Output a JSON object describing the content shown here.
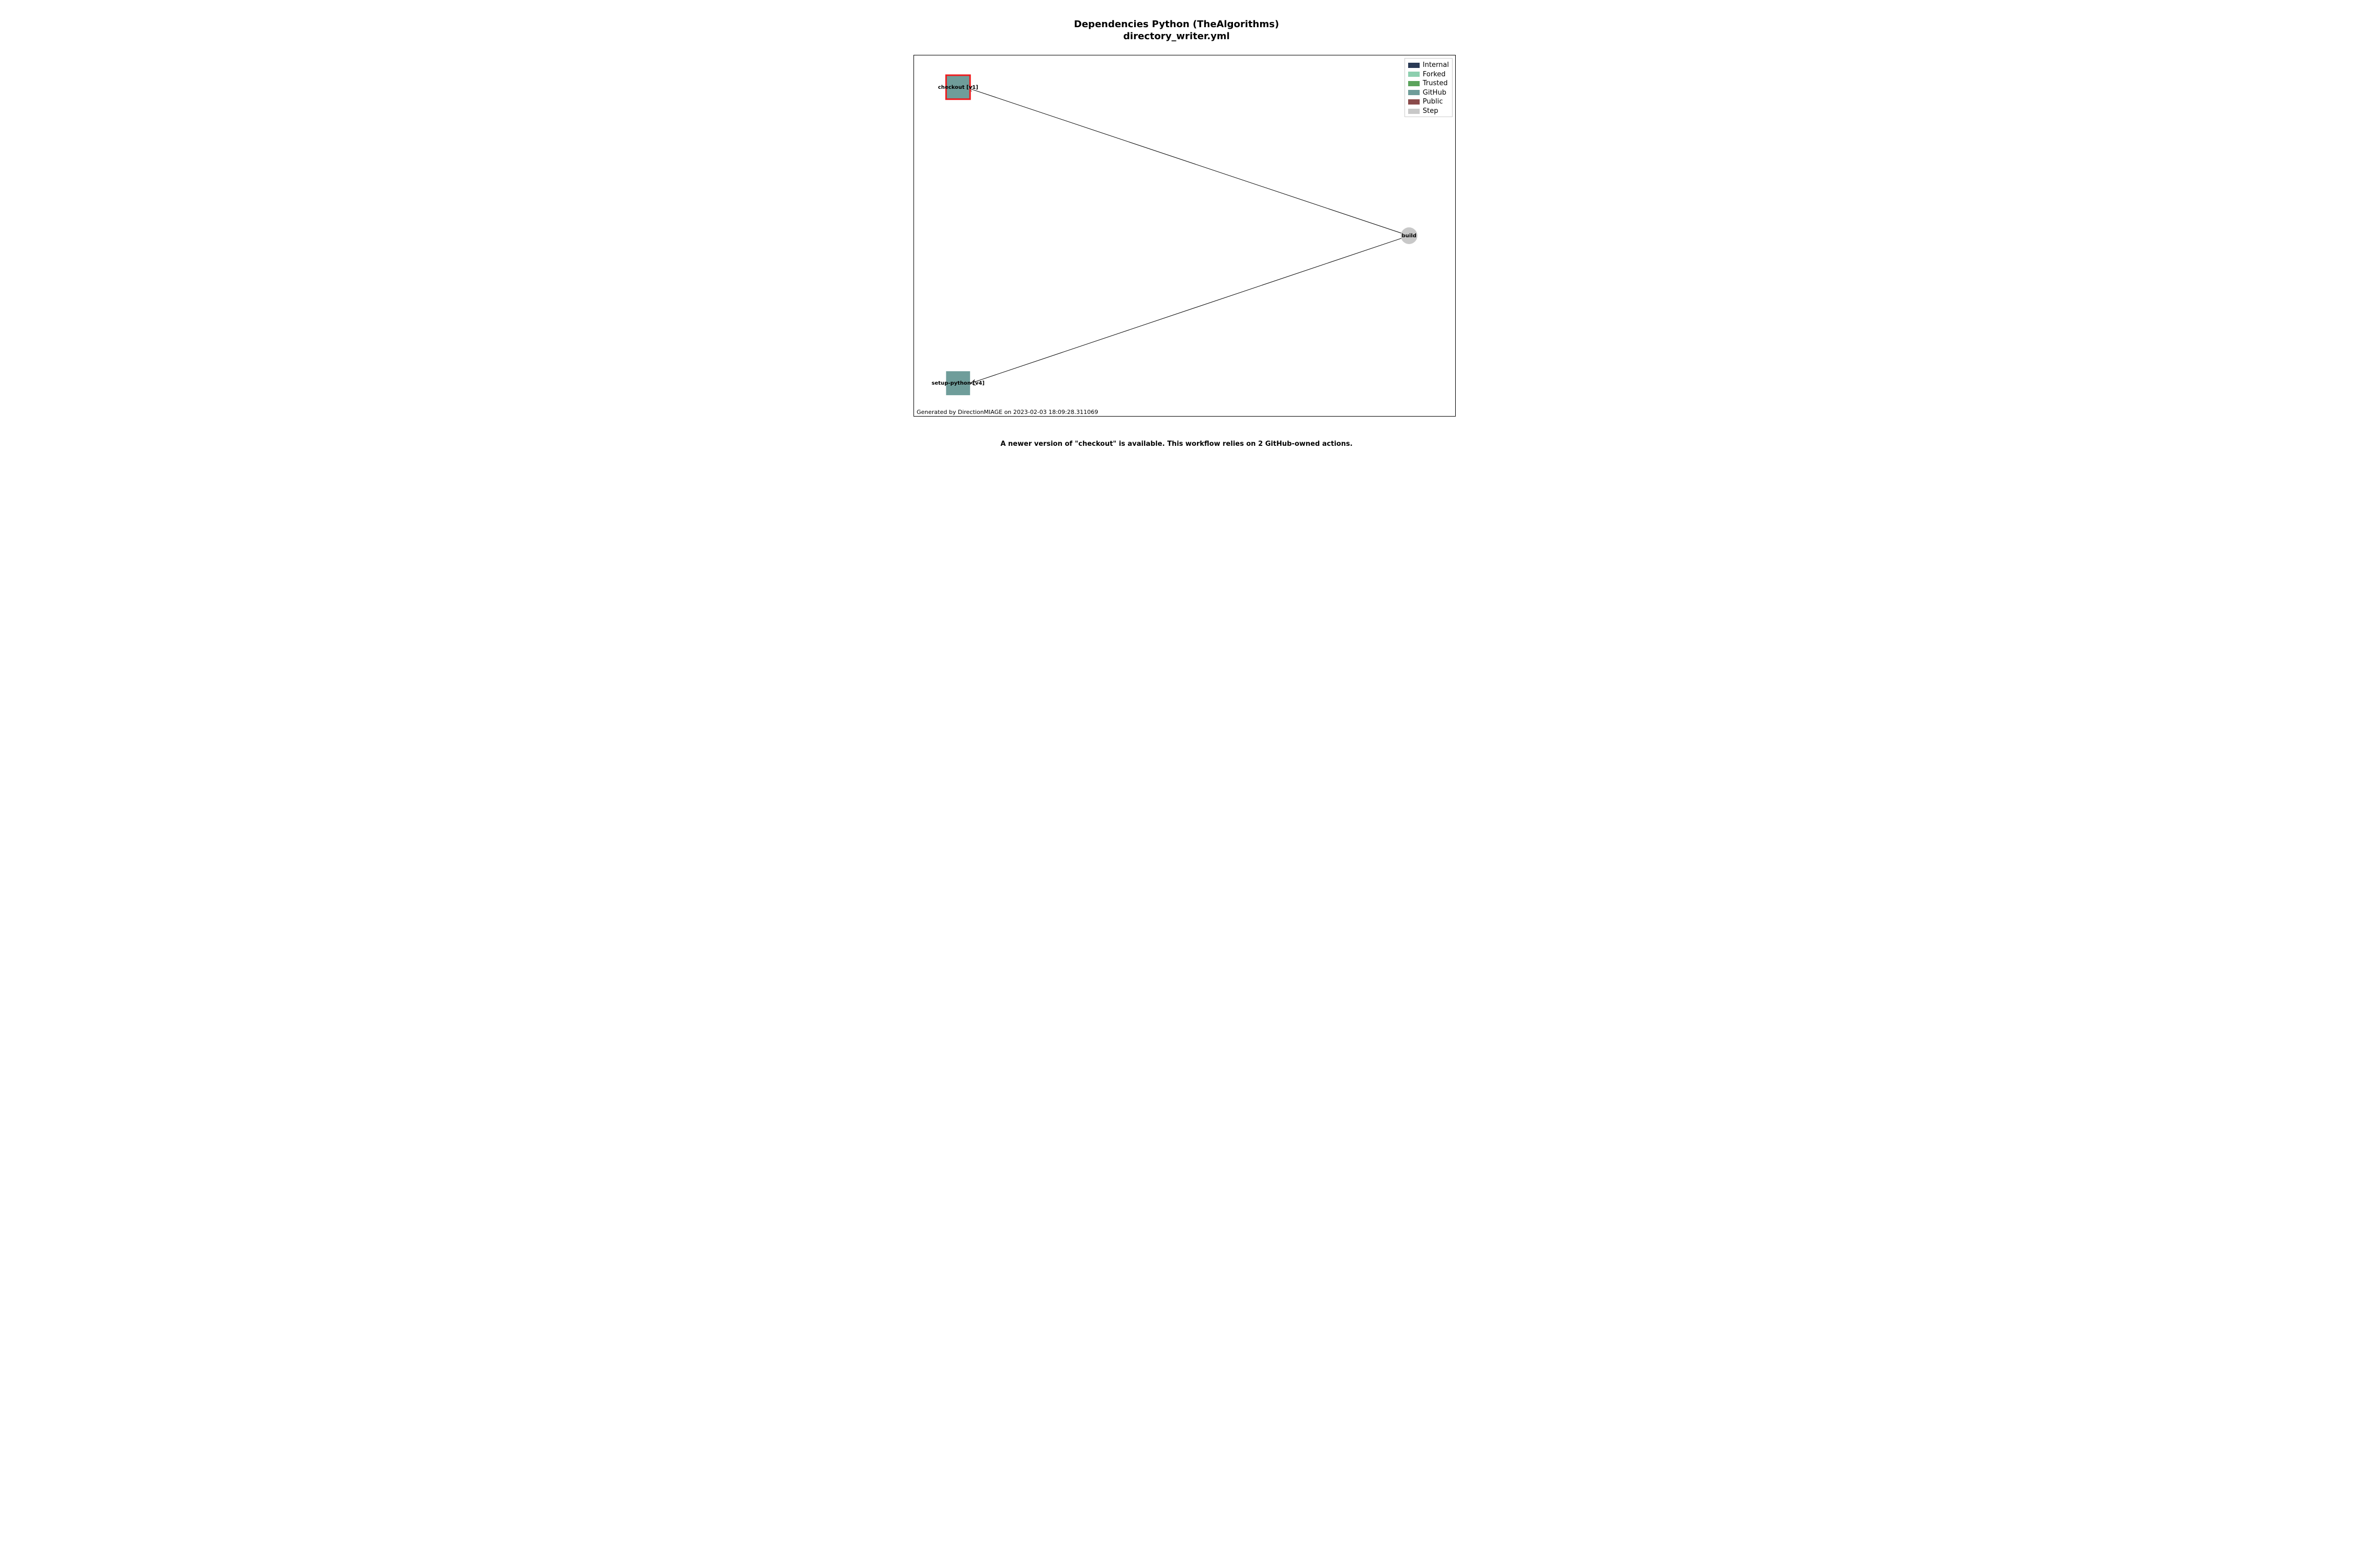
{
  "title": {
    "line1": "Dependencies Python (TheAlgorithms)",
    "line2": "directory_writer.yml"
  },
  "footer_generated": "Generated by DirectionMIAGE on 2023-02-03 18:09:28.311069",
  "caption": "A newer version of \"checkout\" is available. This workflow relies on 2 GitHub-owned actions.",
  "legend": {
    "items": [
      {
        "label": "Internal",
        "color": "#2a3a55"
      },
      {
        "label": "Forked",
        "color": "#8dcfaf"
      },
      {
        "label": "Trusted",
        "color": "#5aa35c"
      },
      {
        "label": "GitHub",
        "color": "#6f9d9a"
      },
      {
        "label": "Public",
        "color": "#8a4a4a"
      },
      {
        "label": "Step",
        "color": "#c8c8c8"
      }
    ]
  },
  "chart_data": {
    "type": "network",
    "nodes": [
      {
        "id": "checkout",
        "label": "checkout [v1]",
        "kind": "GitHub",
        "highlighted": true,
        "x": 0.08,
        "y": 0.915
      },
      {
        "id": "setup-python",
        "label": "setup-python [v4]",
        "kind": "GitHub",
        "highlighted": false,
        "x": 0.08,
        "y": 0.085
      },
      {
        "id": "build",
        "label": "build",
        "kind": "Step",
        "highlighted": false,
        "x": 0.915,
        "y": 0.5
      }
    ],
    "edges": [
      {
        "from": "build",
        "to": "checkout"
      },
      {
        "from": "build",
        "to": "setup-python"
      }
    ],
    "colors": {
      "Internal": "#2a3a55",
      "Forked": "#8dcfaf",
      "Trusted": "#5aa35c",
      "GitHub": "#6f9d9a",
      "Public": "#8a4a4a",
      "Step": "#c8c8c8",
      "highlight_border": "#ef1b1d"
    }
  }
}
